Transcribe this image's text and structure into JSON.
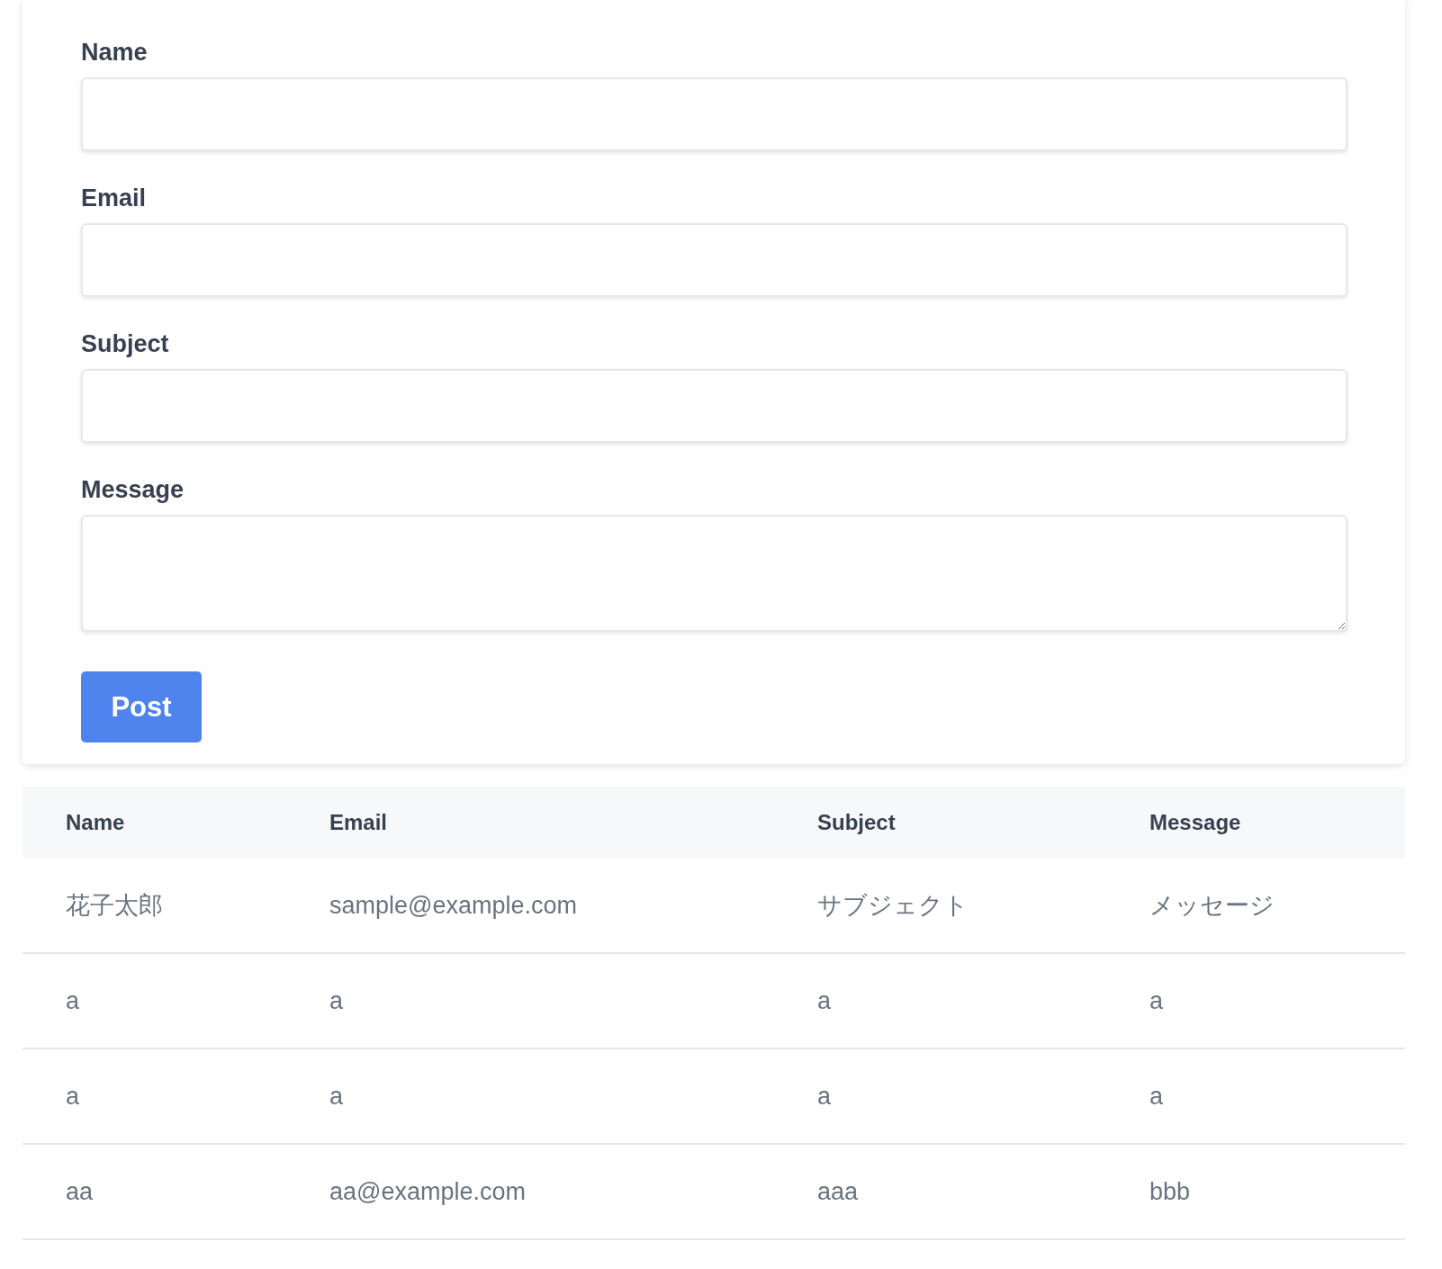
{
  "form": {
    "fields": [
      {
        "label": "Name",
        "kind": "input"
      },
      {
        "label": "Email",
        "kind": "input"
      },
      {
        "label": "Subject",
        "kind": "input"
      },
      {
        "label": "Message",
        "kind": "textarea"
      }
    ],
    "submit": "Post"
  },
  "table": {
    "columns": [
      "Name",
      "Email",
      "Subject",
      "Message"
    ],
    "rows": [
      [
        "花子太郎",
        "sample@example.com",
        "サブジェクト",
        "メッセージ"
      ],
      [
        "a",
        "a",
        "a",
        "a"
      ],
      [
        "a",
        "a",
        "a",
        "a"
      ],
      [
        "aa",
        "aa@example.com",
        "aaa",
        "bbb"
      ]
    ]
  }
}
